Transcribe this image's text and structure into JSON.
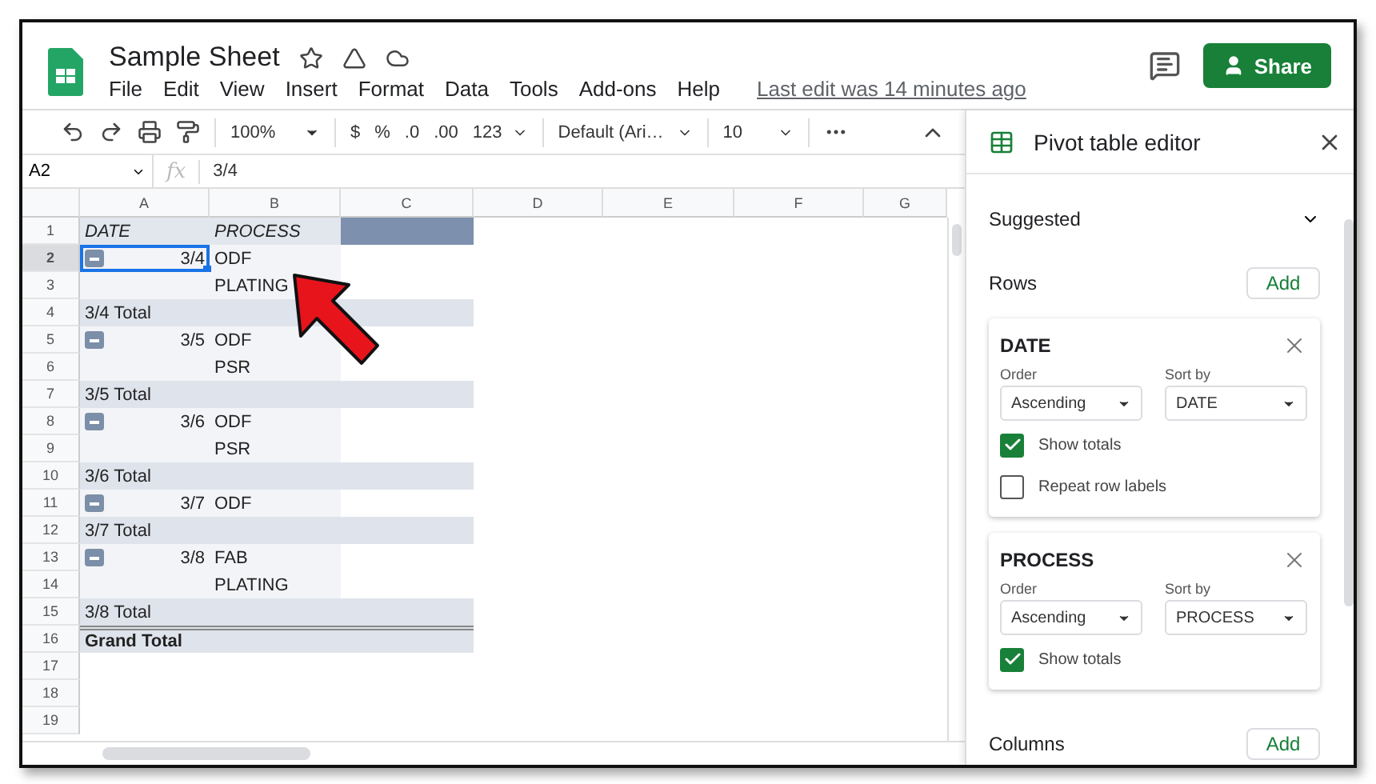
{
  "app": {
    "title": "Sample Sheet",
    "menu": [
      "File",
      "Edit",
      "View",
      "Insert",
      "Format",
      "Data",
      "Tools",
      "Add-ons",
      "Help"
    ],
    "last_edit": "Last edit was 14 minutes ago",
    "share": "Share"
  },
  "toolbar": {
    "zoom": "100%",
    "currency": "$",
    "percent": "%",
    "decrease_decimals": ".0",
    "increase_decimals": ".00",
    "more_formats": "123",
    "font": "Default (Ari…",
    "font_size": "10"
  },
  "formula_bar": {
    "cell": "A2",
    "function_label": "fx",
    "value": "3/4"
  },
  "sheet": {
    "columns": [
      "A",
      "B",
      "C",
      "D",
      "E",
      "F",
      "G"
    ],
    "rows": [
      {
        "number": "1",
        "kind": "header",
        "a": "DATE",
        "b": "PROCESS",
        "selected": false
      },
      {
        "number": "2",
        "kind": "group",
        "expanded": true,
        "a": "3/4",
        "b": "ODF",
        "selected": true
      },
      {
        "number": "3",
        "kind": "item",
        "b": "PLATING",
        "selected": false
      },
      {
        "number": "4",
        "kind": "total",
        "a": "3/4 Total",
        "selected": false
      },
      {
        "number": "5",
        "kind": "group",
        "expanded": true,
        "a": "3/5",
        "b": "ODF",
        "selected": false
      },
      {
        "number": "6",
        "kind": "item",
        "b": "PSR",
        "selected": false
      },
      {
        "number": "7",
        "kind": "total",
        "a": "3/5 Total",
        "selected": false
      },
      {
        "number": "8",
        "kind": "group",
        "expanded": true,
        "a": "3/6",
        "b": "ODF",
        "selected": false
      },
      {
        "number": "9",
        "kind": "item",
        "b": "PSR",
        "selected": false
      },
      {
        "number": "10",
        "kind": "total",
        "a": "3/6 Total",
        "selected": false
      },
      {
        "number": "11",
        "kind": "group",
        "expanded": true,
        "a": "3/7",
        "b": "ODF",
        "selected": false
      },
      {
        "number": "12",
        "kind": "total",
        "a": "3/7 Total",
        "selected": false
      },
      {
        "number": "13",
        "kind": "group",
        "expanded": true,
        "a": "3/8",
        "b": "FAB",
        "selected": false
      },
      {
        "number": "14",
        "kind": "item",
        "b": "PLATING",
        "selected": false
      },
      {
        "number": "15",
        "kind": "total",
        "a": "3/8 Total",
        "selected": false
      },
      {
        "number": "16",
        "kind": "grand",
        "a": "Grand Total",
        "selected": false
      },
      {
        "number": "17",
        "kind": "empty",
        "selected": false
      },
      {
        "number": "18",
        "kind": "empty",
        "selected": false
      },
      {
        "number": "19",
        "kind": "empty",
        "selected": false
      }
    ]
  },
  "pivot_editor": {
    "title": "Pivot table editor",
    "suggested": "Suggested",
    "rows_label": "Rows",
    "add": "Add",
    "row_fields": [
      {
        "name": "DATE",
        "order_label": "Order",
        "order": "Ascending",
        "sort_label": "Sort by",
        "sort": "DATE",
        "options": [
          {
            "label": "Show totals",
            "checked": true
          },
          {
            "label": "Repeat row labels",
            "checked": false
          }
        ]
      },
      {
        "name": "PROCESS",
        "order_label": "Order",
        "order": "Ascending",
        "sort_label": "Sort by",
        "sort": "PROCESS",
        "options": [
          {
            "label": "Show totals",
            "checked": true
          }
        ]
      }
    ],
    "columns_label": "Columns",
    "columns_add": "Add"
  }
}
